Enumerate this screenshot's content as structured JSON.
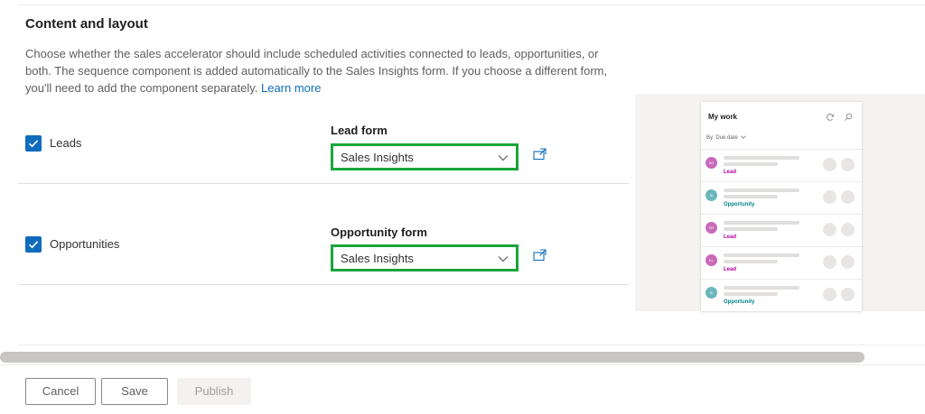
{
  "section": {
    "title": "Content and layout",
    "description": "Choose whether the sales accelerator should include scheduled activities connected to leads, opportunities, or both. The sequence component is added automatically to the Sales Insights form. If you choose a different form, you'll need to add the component separately.",
    "learn_more": "Learn more"
  },
  "rows": [
    {
      "checkbox_label": "Leads",
      "checked": true,
      "form_label": "Lead form",
      "form_value": "Sales Insights"
    },
    {
      "checkbox_label": "Opportunities",
      "checked": true,
      "form_label": "Opportunity form",
      "form_value": "Sales Insights"
    }
  ],
  "preview": {
    "title": "My work",
    "filter": "By: Due date",
    "items": [
      {
        "initials": "SH",
        "tag": "Lead",
        "tag_color": "#b4009e",
        "avatar_color": "#c86ab9"
      },
      {
        "initials": "SI",
        "tag": "Opportunity",
        "tag_color": "#038387",
        "avatar_color": "#69b7bd"
      },
      {
        "initials": "SH",
        "tag": "Lead",
        "tag_color": "#b4009e",
        "avatar_color": "#c86ab9"
      },
      {
        "initials": "KL",
        "tag": "Lead",
        "tag_color": "#b4009e",
        "avatar_color": "#c86ab9"
      },
      {
        "initials": "SI",
        "tag": "Opportunity",
        "tag_color": "#038387",
        "avatar_color": "#69b7bd"
      }
    ]
  },
  "footer": {
    "cancel": "Cancel",
    "save": "Save",
    "publish": "Publish"
  },
  "colors": {
    "accent": "#0f6cbd",
    "highlight_border": "#1aa53a"
  }
}
